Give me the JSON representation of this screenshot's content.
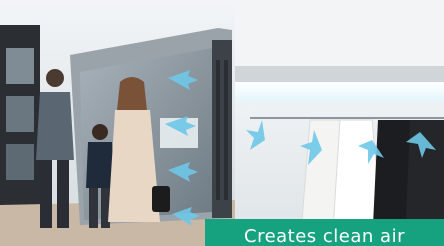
{
  "caption": {
    "text": "Creates clean air"
  },
  "colors": {
    "caption_background": "#17a27f",
    "caption_text": "#ffffff",
    "airflow_arrows": "#6ec8e8"
  }
}
